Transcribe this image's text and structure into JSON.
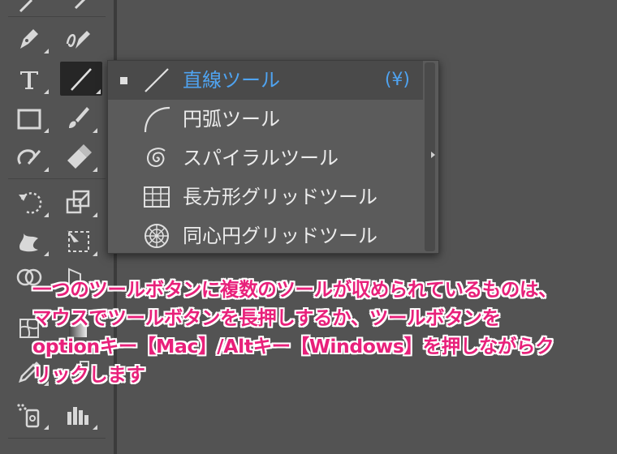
{
  "flyout": {
    "items": [
      {
        "label": "直線ツール",
        "shortcut": "(¥)",
        "icon": "line-segment-icon",
        "selected": true
      },
      {
        "label": "円弧ツール",
        "icon": "arc-icon"
      },
      {
        "label": "スパイラルツール",
        "icon": "spiral-icon"
      },
      {
        "label": "長方形グリッドツール",
        "icon": "rectangular-grid-icon"
      },
      {
        "label": "同心円グリッドツール",
        "icon": "polar-grid-icon"
      }
    ]
  },
  "annotation": {
    "lines": [
      "一つのツールボタンに複数のツールが収められているものは、",
      "マウスでツールボタンを長押しするか、ツールボタンを",
      "optionキー【Mac】/Altキー【Windows】を押しながらク",
      "リックします"
    ]
  },
  "toolbar": {
    "tools": [
      "selection-icon",
      "direct-selection-icon",
      "pen-icon",
      "curvature-icon",
      "type-icon",
      "line-segment-icon",
      "rectangle-icon",
      "paintbrush-icon",
      "shaper-icon",
      "eraser-icon",
      "rotate-icon",
      "scale-icon",
      "warp-icon",
      "free-transform-icon",
      "shape-builder-icon",
      "perspective-grid-icon",
      "mesh-icon",
      "gradient-icon",
      "eyedropper-icon",
      "blend-icon",
      "symbol-sprayer-icon",
      "column-graph-icon"
    ]
  },
  "colors": {
    "background": "#535353",
    "highlight": "#4fa3f0",
    "annotation": "#e8207a"
  }
}
